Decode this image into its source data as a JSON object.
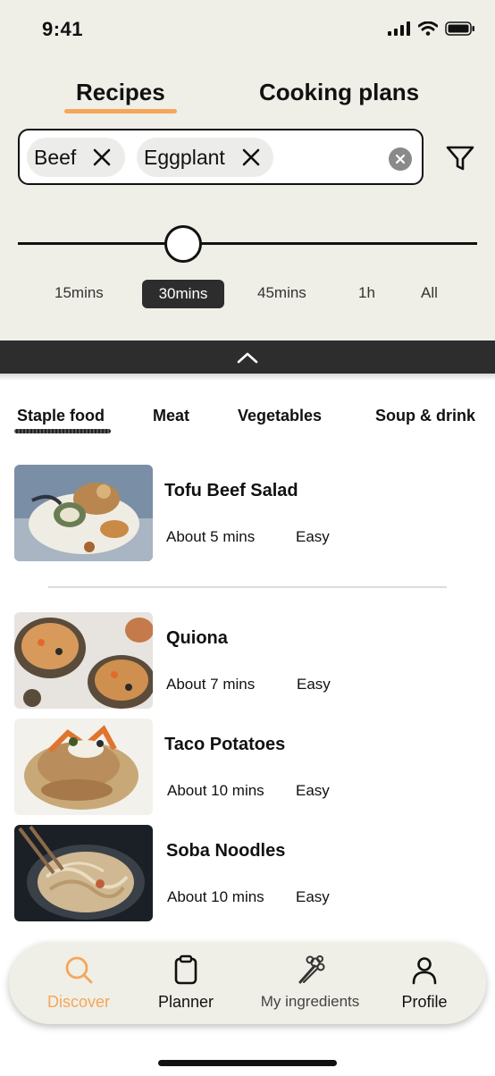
{
  "status_bar": {
    "time": "9:41"
  },
  "main_tabs": {
    "recipes": "Recipes",
    "cooking_plans": "Cooking plans",
    "active": "Recipes"
  },
  "search": {
    "chips": [
      "Beef",
      "Eggplant"
    ]
  },
  "time_filter": {
    "options": [
      "15mins",
      "30mins",
      "45mins",
      "1h",
      "All"
    ],
    "selected": "30mins",
    "slider_level": 0.36
  },
  "categories": {
    "items": [
      "Staple food",
      "Meat",
      "Vegetables",
      "Soup & drink"
    ],
    "active": "Staple food"
  },
  "recipes": [
    {
      "title": "Tofu Beef Salad",
      "time": "About 5 mins",
      "level": "Easy"
    },
    {
      "title": "Quiona",
      "time": "About 7 mins",
      "level": "Easy"
    },
    {
      "title": "Taco Potatoes",
      "time": "About 10 mins",
      "level": "Easy"
    },
    {
      "title": "Soba Noodles",
      "time": "About 10 mins",
      "level": "Easy"
    }
  ],
  "nav": {
    "items": [
      "Discover",
      "Planner",
      "My ingredients",
      "Profile"
    ],
    "active": "Discover",
    "icons": [
      "search-icon",
      "clipboard-icon",
      "celery-icon",
      "person-icon"
    ]
  },
  "colors": {
    "accent": "#f5a65b",
    "top_bg": "#efefe7",
    "dark": "#2d2d2d"
  }
}
